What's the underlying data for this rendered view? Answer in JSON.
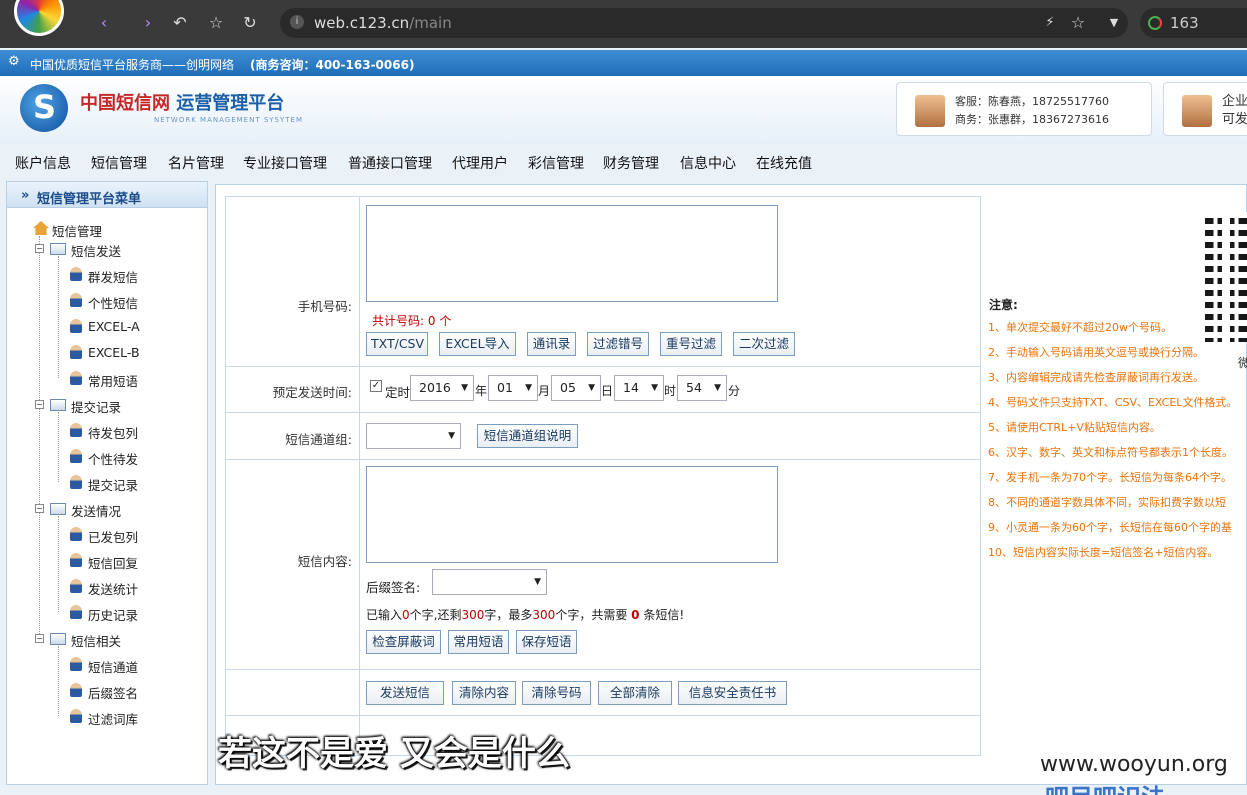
{
  "browser": {
    "url_host": "web.c123.cn",
    "url_path": "/main",
    "search_text": "163"
  },
  "topstrip": {
    "slogan": "中国优质短信平台服务商——创明网络",
    "hotline": "(商务咨询：400-163-0066)"
  },
  "header": {
    "title_red": "中国短信网",
    "title_blue": "运营管理平台",
    "subtitle": "NETWORK MANAGEMENT SYSYTEM",
    "contact1_line1": "客服：陈春燕，18725517760",
    "contact1_line2": "商务：张惠群，18367273616",
    "contact2_line1": "企业",
    "contact2_line2": "可发"
  },
  "nav": [
    "账户信息",
    "短信管理",
    "名片管理",
    "专业接口管理",
    "普通接口管理",
    "代理用户",
    "彩信管理",
    "财务管理",
    "信息中心",
    "在线充值"
  ],
  "sidebar": {
    "title": "短信管理平台菜单",
    "root": "短信管理",
    "groups": [
      {
        "label": "短信发送",
        "items": [
          "群发短信",
          "个性短信",
          "EXCEL-A",
          "EXCEL-B",
          "常用短语"
        ]
      },
      {
        "label": "提交记录",
        "items": [
          "待发包列",
          "个性待发",
          "提交记录"
        ]
      },
      {
        "label": "发送情况",
        "items": [
          "已发包列",
          "短信回复",
          "发送统计",
          "历史记录"
        ]
      },
      {
        "label": "短信相关",
        "items": [
          "短信通道",
          "后缀签名",
          "过滤词库"
        ]
      }
    ]
  },
  "form": {
    "phone_label": "手机号码:",
    "phone_count_prefix": "共计号码:",
    "phone_count": "0",
    "phone_count_unit": "个",
    "phone_buttons": [
      "TXT/CSV",
      "EXCEL导入",
      "通讯录",
      "过滤错号",
      "重号过滤",
      "二次过滤"
    ],
    "schedule_label": "预定发送时间:",
    "schedule_check_label": "定时",
    "year": "2016",
    "year_unit": "年",
    "month": "01",
    "month_unit": "月",
    "day": "05",
    "day_unit": "日",
    "hour": "14",
    "hour_unit": "时",
    "minute": "54",
    "minute_unit": "分",
    "channel_label": "短信通道组:",
    "channel_button": "短信通道组说明",
    "content_label": "短信内容:",
    "suffix_label": "后缀签名:",
    "count_text_1": "已输入",
    "count_entered": "0",
    "count_text_2": "个字,还剩",
    "count_left": "300",
    "count_text_3": "字，最多",
    "count_max": "300",
    "count_text_4": "个字，共需要",
    "count_msgs": "0",
    "count_text_5": "条短信!",
    "content_buttons": [
      "检查屏蔽词",
      "常用短语",
      "保存短语"
    ],
    "action_buttons": [
      "发送短信",
      "清除内容",
      "清除号码",
      "全部清除",
      "信息安全责任书"
    ]
  },
  "notes": {
    "title": "注意:",
    "items": [
      "1、单次提交最好不超过20w个号码。",
      "2、手动输入号码请用英文逗号或换行分隔。",
      "3、内容编辑完成请先检查屏蔽词再行发送。",
      "4、号码文件只支持TXT、CSV、EXCEL文件格式。",
      "5、请使用CTRL+V粘贴短信内容。",
      "6、汉字、数字、英文和标点符号都表示1个长度。",
      "7、发手机一条为70个字。长短信为每条64个字。",
      "8、不同的通道字数具体不同，实际扣费字数以短",
      "9、小灵通一条为60个字，长短信在每60个字的基",
      "10、短信内容实际长度=短信签名+短信内容。"
    ],
    "qr_caption": "微"
  },
  "overlay": {
    "subtitle": "若这不是爱 又会是什么",
    "watermark": "www.wooyun.org",
    "watermark2": "吧目吧识法"
  }
}
